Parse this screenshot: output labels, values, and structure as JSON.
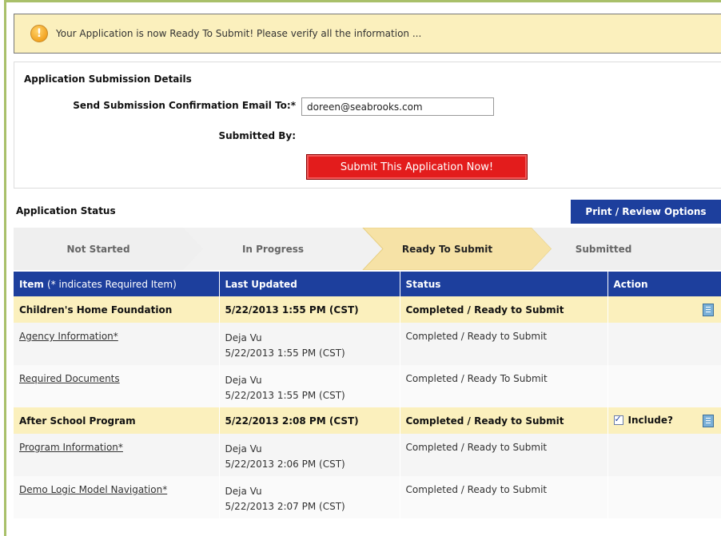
{
  "alert": {
    "icon": "warning-icon",
    "text": "Your Application is now Ready To Submit! Please verify all the information ..."
  },
  "details": {
    "title": "Application Submission Details",
    "email_label": "Send Submission Confirmation Email To:*",
    "email_value": "doreen@seabrooks.com",
    "submitted_by_label": "Submitted By:",
    "submit_button": "Submit This Application Now!"
  },
  "status": {
    "title": "Application Status",
    "print_button": "Print / Review Options",
    "steps": [
      {
        "label": "Not Started",
        "active": false
      },
      {
        "label": "In Progress",
        "active": false
      },
      {
        "label": "Ready To Submit",
        "active": true
      },
      {
        "label": "Submitted",
        "active": false
      }
    ]
  },
  "table": {
    "headers": {
      "item": "Item",
      "item_note": "(* indicates Required Item)",
      "updated": "Last Updated",
      "status": "Status",
      "action": "Action"
    },
    "groups": [
      {
        "name": "Children's Home Foundation",
        "updated": "5/22/2013 1:55 PM (CST)",
        "status": "Completed / Ready to Submit",
        "include_label": "",
        "include_checked": false,
        "items": [
          {
            "name": "Agency Information*",
            "user": "Deja Vu",
            "updated": "5/22/2013 1:55 PM (CST)",
            "status": "Completed / Ready to Submit"
          },
          {
            "name": "Required Documents",
            "user": "Deja Vu",
            "updated": "5/22/2013 1:55 PM (CST)",
            "status": "Completed / Ready To Submit"
          }
        ]
      },
      {
        "name": "After School Program",
        "updated": "5/22/2013 2:08 PM (CST)",
        "status": "Completed / Ready to Submit",
        "include_label": "Include?",
        "include_checked": true,
        "items": [
          {
            "name": "Program Information*",
            "user": "Deja Vu",
            "updated": "5/22/2013 2:06 PM (CST)",
            "status": "Completed / Ready to Submit"
          },
          {
            "name": "Demo Logic Model Navigation*",
            "user": "Deja Vu",
            "updated": "5/22/2013 2:07 PM (CST)",
            "status": "Completed / Ready to Submit"
          }
        ]
      }
    ]
  },
  "colors": {
    "accent_blue": "#1d3f9d",
    "alert_bg": "#fbf0bd",
    "submit_red": "#e31c1c",
    "frame_green": "#a9c06a"
  }
}
